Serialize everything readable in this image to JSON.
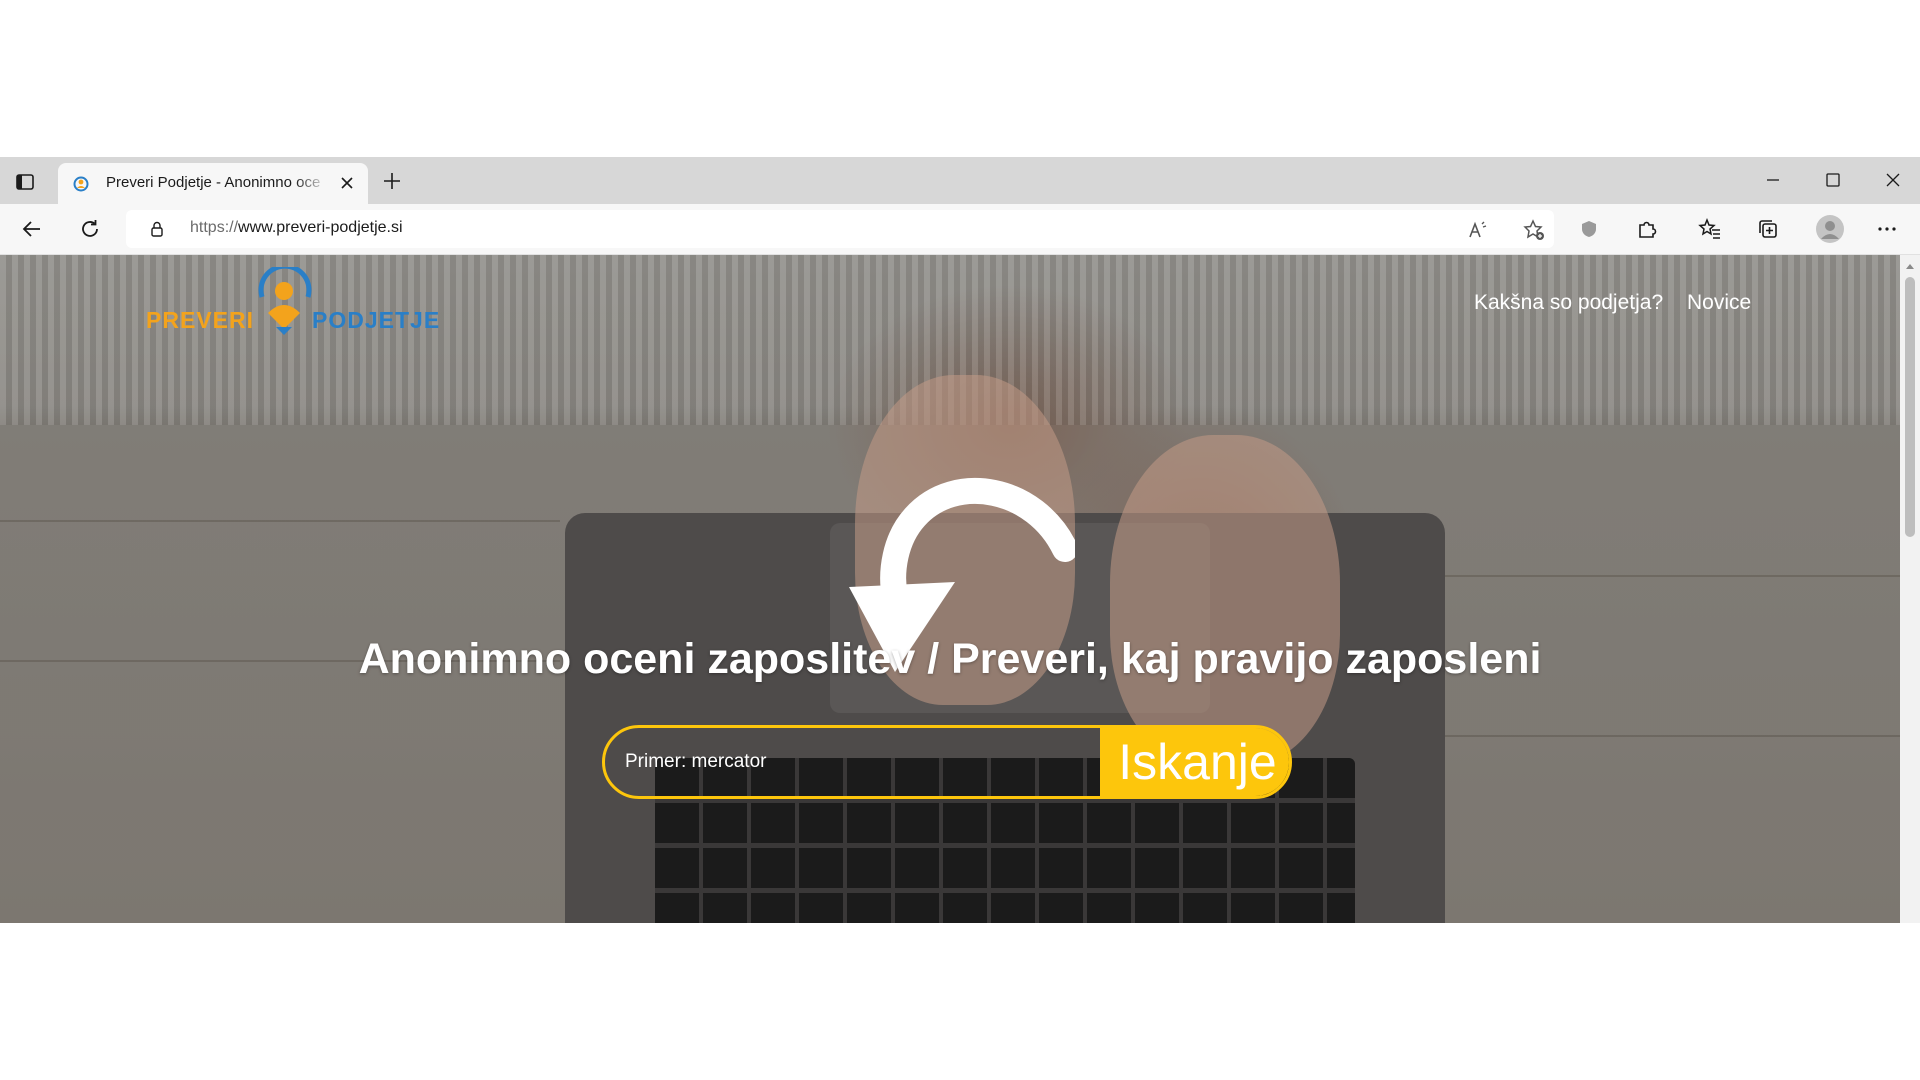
{
  "browser": {
    "tab": {
      "title": "Preveri Podjetje - Anonimno oce"
    },
    "address": {
      "protocol": "https://",
      "host": "www.preveri-podjetje.si"
    },
    "icons": {
      "tab_actions": "tab-actions-icon",
      "favicon": "site-favicon",
      "close_tab": "close-icon",
      "new_tab": "plus-icon",
      "minimize": "minimize-icon",
      "maximize": "maximize-icon",
      "close_window": "close-icon",
      "back": "back-arrow-icon",
      "refresh": "refresh-icon",
      "lock": "lock-icon",
      "read_aloud": "read-aloud-icon",
      "add_favorite": "add-favorite-icon",
      "tracking": "shield-icon",
      "extensions": "puzzle-icon",
      "favorites": "favorites-icon",
      "collections": "collections-icon",
      "profile": "avatar-icon",
      "more": "more-icon"
    }
  },
  "page": {
    "logo": {
      "word1": "PREVERI",
      "word2": "PODJETJE"
    },
    "nav": {
      "item1": "Kakšna so podjetja?",
      "item2": "Novice"
    },
    "headline": "Anonimno oceni zaposlitev / Preveri, kaj pravijo zaposleni",
    "search": {
      "placeholder": "Primer: mercator",
      "button_label": "Iskanje"
    }
  },
  "colors": {
    "accent_yellow": "#fdc60c",
    "logo_orange": "#f3a31c",
    "logo_blue": "#2a7fc7"
  }
}
